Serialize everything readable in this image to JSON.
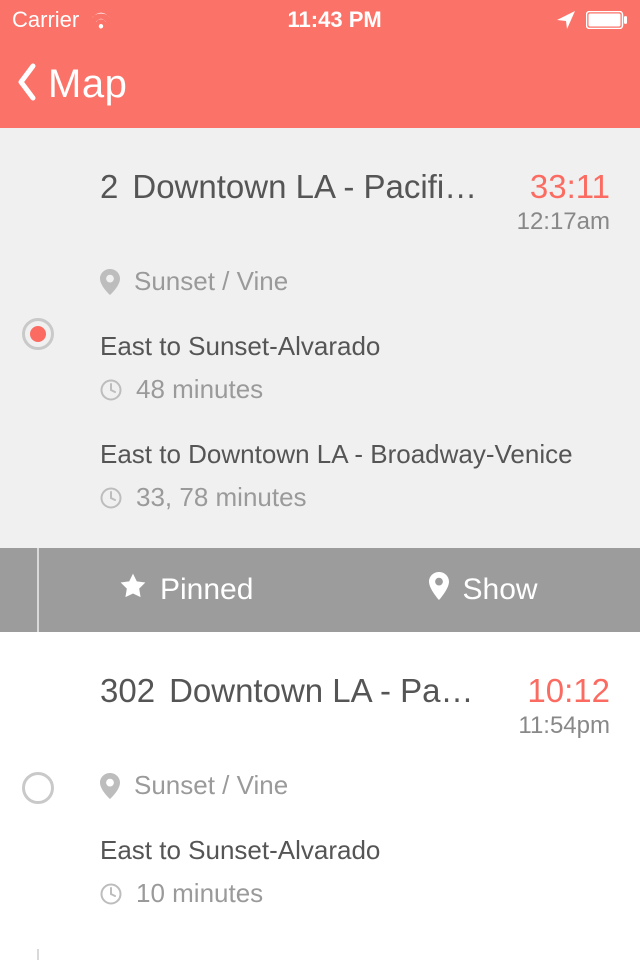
{
  "status": {
    "carrier": "Carrier",
    "time": "11:43 PM"
  },
  "nav": {
    "back_label": "Map"
  },
  "colors": {
    "accent": "#fb6b61"
  },
  "action_bar": {
    "pinned": "Pinned",
    "show": "Show"
  },
  "routes": [
    {
      "number": "2",
      "name": "Downtown LA - Pacific Pali…",
      "countdown": "33:11",
      "arrival": "12:17am",
      "stop": "Sunset / Vine",
      "active": true,
      "directions": [
        {
          "label": "East to Sunset-Alvarado",
          "wait": "48 minutes"
        },
        {
          "label": "East to Downtown LA - Broadway-Venice",
          "wait": "33, 78 minutes"
        }
      ]
    },
    {
      "number": "302",
      "name": "Downtown LA - Pacific P…",
      "countdown": "10:12",
      "arrival": "11:54pm",
      "stop": "Sunset / Vine",
      "active": false,
      "directions": [
        {
          "label": "East to Sunset-Alvarado",
          "wait": "10 minutes"
        }
      ]
    }
  ]
}
